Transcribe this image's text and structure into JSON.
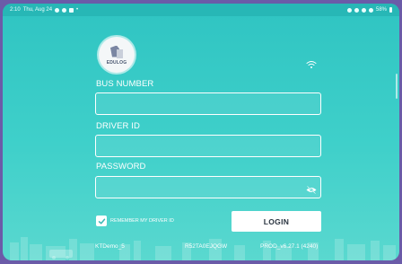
{
  "status_bar": {
    "time": "2:10",
    "date": "Thu, Aug 24",
    "battery": "58%"
  },
  "logo": {
    "text": "EDULOG"
  },
  "form": {
    "bus_number_label": "BUS NUMBER",
    "bus_number_value": "",
    "driver_id_label": "DRIVER ID",
    "driver_id_value": "",
    "password_label": "PASSWORD",
    "password_value": "",
    "remember_label": "REMEMBER MY DRIVER ID",
    "remember_checked": true,
    "login_label": "LOGIN"
  },
  "footer": {
    "device_name": "KTDemo_5",
    "serial": "R52TA0EJQGW",
    "version": "PROD_v6.27.1 (4240)"
  },
  "colors": {
    "teal": "#3fd0ca",
    "frame_border": "#6b5ba8",
    "white": "#ffffff"
  }
}
